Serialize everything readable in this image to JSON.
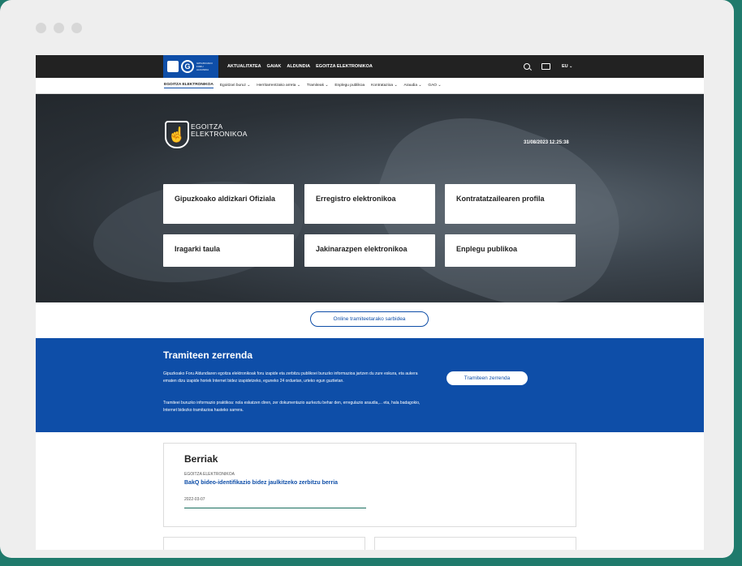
{
  "header": {
    "logo_text": "GIPUZKOAKO FORU ALDUNDIA",
    "nav": [
      "AKTUALITATEA",
      "GAIAK",
      "ALDUNDIA",
      "EGOITZA ELEKTRONIKOA"
    ],
    "language": "EU"
  },
  "subnav": {
    "items": [
      {
        "label": "EGOITZA ELEKTRONIKOA",
        "active": true,
        "chevron": false
      },
      {
        "label": "Egoitzari buruz",
        "active": false,
        "chevron": true
      },
      {
        "label": "Herritarrentzako arreta",
        "active": false,
        "chevron": true
      },
      {
        "label": "Tramiteak",
        "active": false,
        "chevron": true
      },
      {
        "label": "Enplegu publikoa",
        "active": false,
        "chevron": false
      },
      {
        "label": "Kontratazioa",
        "active": false,
        "chevron": true
      },
      {
        "label": "Araudia",
        "active": false,
        "chevron": true
      },
      {
        "label": "GAO",
        "active": false,
        "chevron": true
      }
    ]
  },
  "hero": {
    "title_line1": "EGOITZA",
    "title_line2": "ELEKTRONIKOA",
    "datetime": "31/08/2023 12:25:38",
    "cards": [
      "Gipuzkoako aldizkari Ofiziala",
      "Erregistro elektronikoa",
      "Kontratatzailearen profila",
      "Iragarki taula",
      "Jakinarazpen elektronikoa",
      "Enplegu publikoa"
    ]
  },
  "online_button": "Online tramiteetarako sarbidea",
  "tramiteen": {
    "title": "Tramiteen zerrenda",
    "paragraph1": "Gipuzkoako Foru Aldundiaren egoitza elektronikoak foru izapide eta zerbitzu publikoei buruzko informazioa jartzen du zure eskura, eta aukera ematen dizu izapide horiek Internet bidez izapidetzeko, eguneko 24 orduetan, urteko egun guztietan.",
    "paragraph2": "Tramiteei buruzko informazio praktikoa: nola eskatzen diren, zer dokumentazio aurkeztu behar den, erregulazio araudia,... eta, hala badagokio, Internet bidezko tramitazioa hasteko sarrera.",
    "button": "Tramiteen zerrenda"
  },
  "news": {
    "title": "Berriak",
    "category": "EGOITZA ELEKTRONIKOA",
    "headline": "BakQ bideo-identifikazio bidez jaulkitzeko zerbitzu berria",
    "date": "2022-03-07"
  },
  "colors": {
    "brand_blue": "#0e4ea8",
    "topbar": "#222222",
    "outer_bg": "#1f7a6c"
  }
}
